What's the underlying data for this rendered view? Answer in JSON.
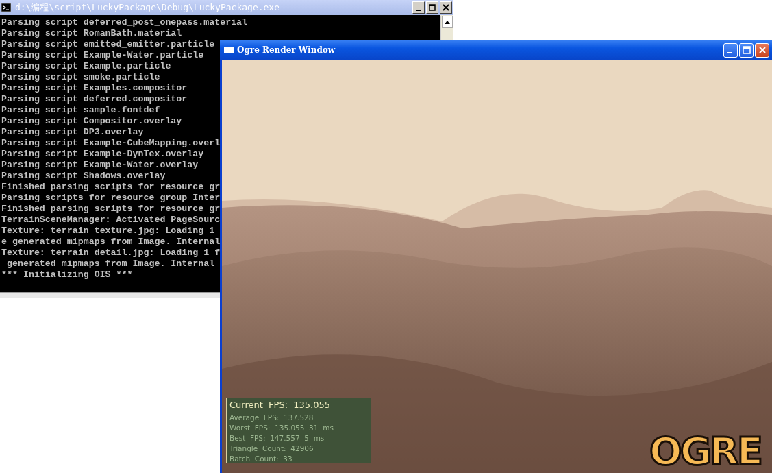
{
  "console_window": {
    "title": "d:\\编程\\script\\LuckyPackage\\Debug\\LuckyPackage.exe",
    "lines": [
      "Parsing script deferred_post_onepass.material",
      "Parsing script RomanBath.material",
      "Parsing script emitted_emitter.particle",
      "Parsing script Example-Water.particle",
      "Parsing script Example.particle",
      "Parsing script smoke.particle",
      "Parsing script Examples.compositor",
      "Parsing script deferred.compositor",
      "Parsing script sample.fontdef",
      "Parsing script Compositor.overlay",
      "Parsing script DP3.overlay",
      "Parsing script Example-CubeMapping.overl",
      "Parsing script Example-DynTex.overlay",
      "Parsing script Example-Water.overlay",
      "Parsing script Shadows.overlay",
      "Finished parsing scripts for resource gr",
      "Parsing scripts for resource group Inter",
      "Finished parsing scripts for resource gr",
      "TerrainSceneManager: Activated PageSourc",
      "Texture: terrain_texture.jpg: Loading 1",
      "e generated mipmaps from Image. Internal",
      "Texture: terrain_detail.jpg: Loading 1 f",
      " generated mipmaps from Image. Internal",
      "*** Initializing OIS ***"
    ]
  },
  "render_window": {
    "title": "Ogre Render Window",
    "stats": {
      "current": "Current  FPS:  135.055",
      "lines": [
        "Average  FPS:  137.528",
        "Worst  FPS:  135.055  31  ms",
        "Best  FPS:  147.557  5  ms",
        "Triangle  Count:  42906",
        "Batch  Count:  33"
      ]
    },
    "logo": "OGRE"
  }
}
